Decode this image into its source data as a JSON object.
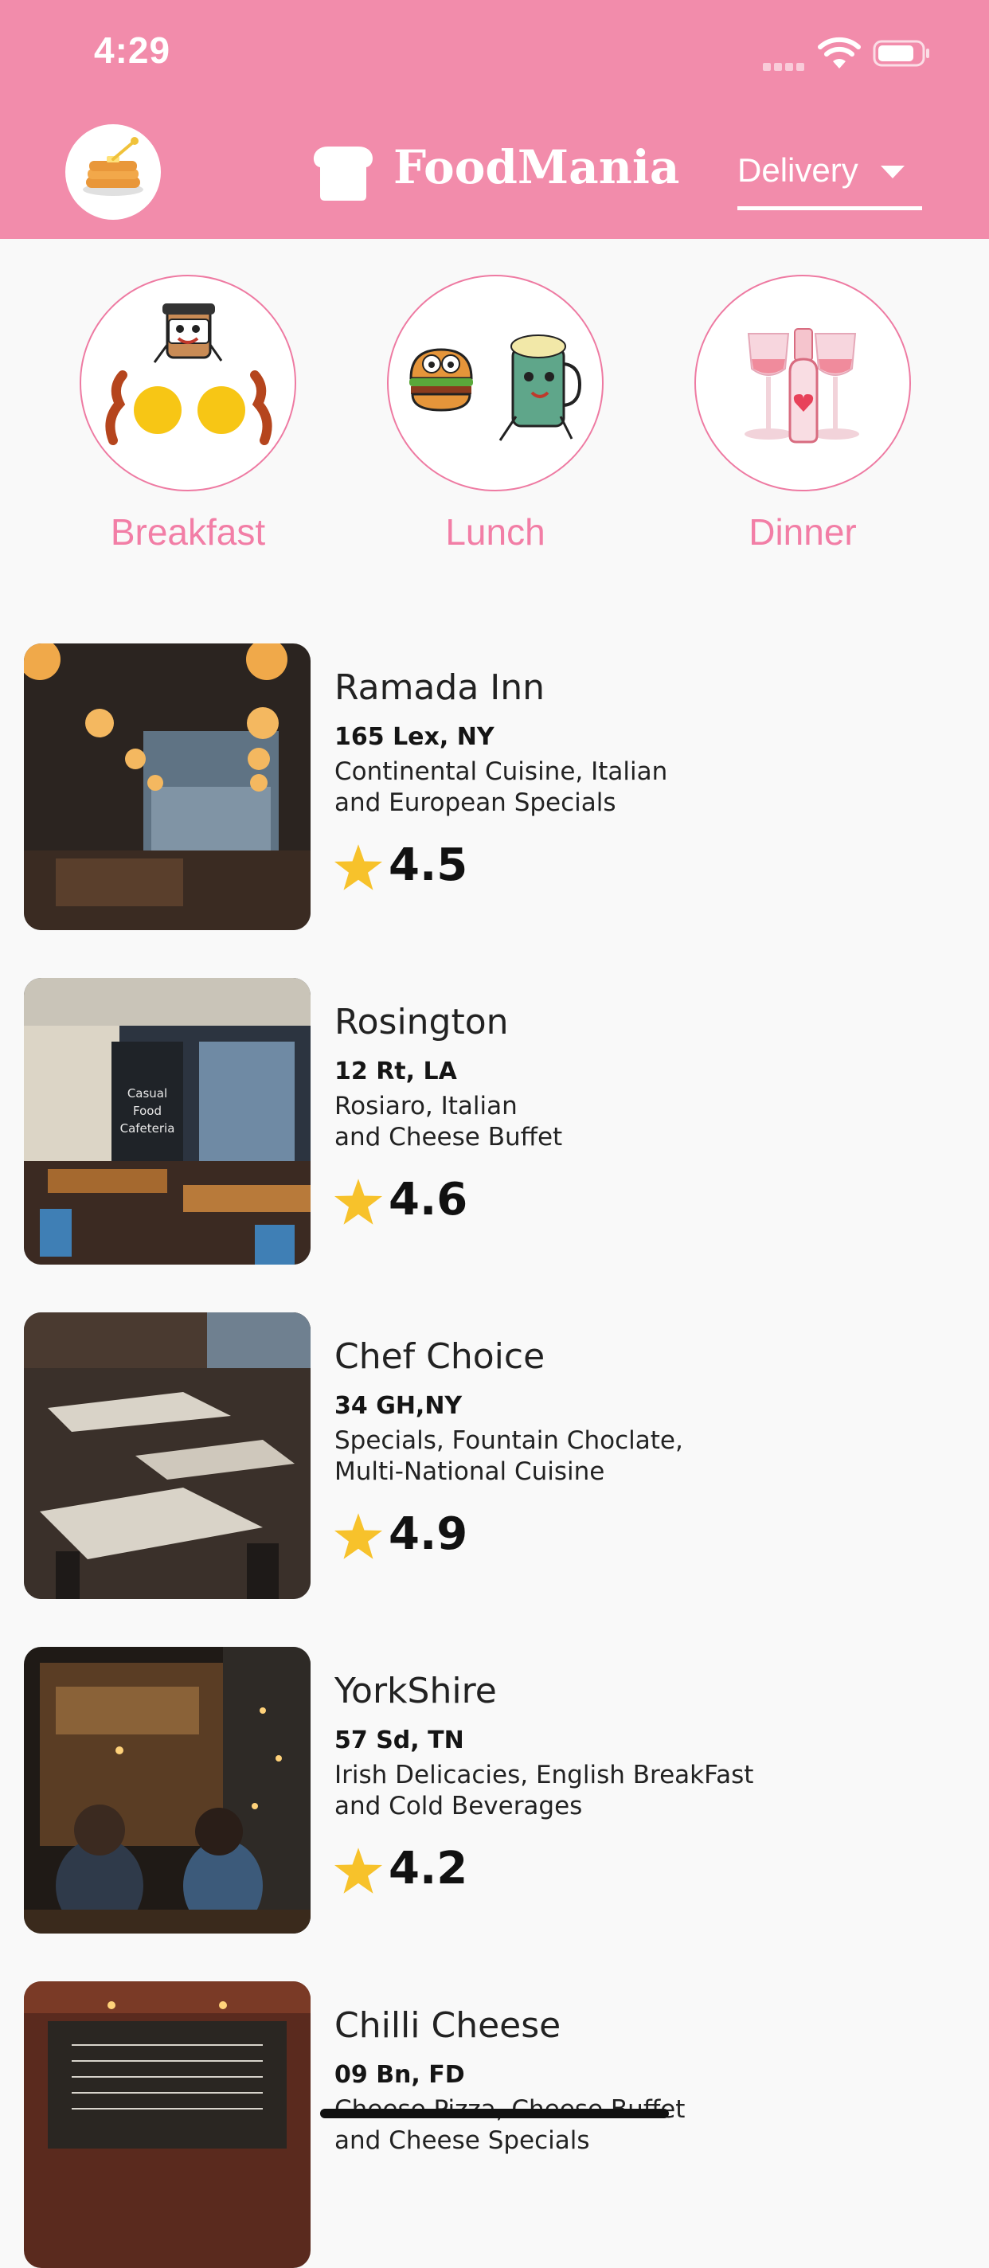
{
  "status_bar": {
    "time": "4:29"
  },
  "header": {
    "brand": "FoodMania",
    "order_mode": "Delivery"
  },
  "categories": [
    {
      "label": "Breakfast"
    },
    {
      "label": "Lunch"
    },
    {
      "label": "Dinner"
    }
  ],
  "restaurants": [
    {
      "name": "Ramada Inn",
      "address": "165 Lex, NY",
      "desc_line1": "Continental Cuisine, Italian",
      "desc_line2": "and European Specials",
      "rating": "4.5"
    },
    {
      "name": "Rosington",
      "address": "12 Rt, LA",
      "desc_line1": "Rosiaro, Italian",
      "desc_line2": "and Cheese Buffet",
      "rating": "4.6"
    },
    {
      "name": "Chef Choice",
      "address": "34 GH,NY",
      "desc_line1": "Specials, Fountain Choclate,",
      "desc_line2": "Multi-National Cuisine",
      "rating": "4.9"
    },
    {
      "name": "YorkShire",
      "address": "57 Sd, TN",
      "desc_line1": "Irish Delicacies, English BreakFast",
      "desc_line2": "and Cold Beverages",
      "rating": "4.2"
    },
    {
      "name": "Chilli Cheese",
      "address": "09 Bn, FD",
      "desc_line1": "Cheese Pizza, Cheese Buffet",
      "desc_line2": "and Cheese Specials",
      "rating": ""
    }
  ],
  "photo_signs": {
    "cafeteria_sign": [
      "Casual",
      "Food",
      "Cafeteria"
    ]
  },
  "colors": {
    "header": "#f28cab",
    "accent": "#f27ea6",
    "star": "#f7c22b",
    "background": "#f9f9f9"
  },
  "icons": {
    "avatar": "pancake-stack-icon",
    "brand": "bread-loaf-icon",
    "dropdown": "caret-down-icon",
    "rating": "star-icon"
  }
}
